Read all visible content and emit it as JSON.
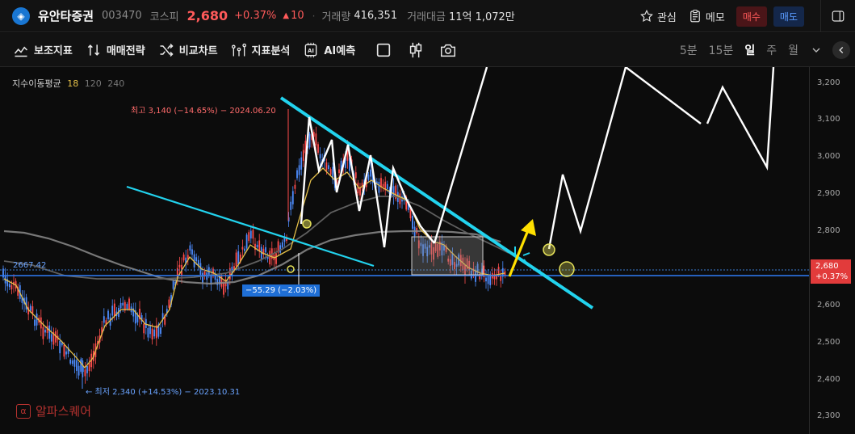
{
  "header": {
    "logo_glyph": "◈",
    "stock_name": "유안타증권",
    "stock_code": "003470",
    "market": "코스피",
    "price": "2,680",
    "change_pct": "+0.37%",
    "change_arrow": "▲",
    "change_value": "10",
    "separator": "·",
    "volume_label": "거래량",
    "volume_value": "416,351",
    "amount_label": "거래대금",
    "amount_value": "11억 1,072만",
    "watch_label": "관심",
    "memo_label": "메모",
    "buy_label": "매수",
    "sell_label": "매도"
  },
  "toolbar": {
    "items": [
      {
        "label": "보조지표",
        "icon": "indicator-icon"
      },
      {
        "label": "매매전략",
        "icon": "strategy-icon"
      },
      {
        "label": "비교차트",
        "icon": "compare-icon"
      },
      {
        "label": "지표분석",
        "icon": "analysis-icon"
      },
      {
        "label": "AI예측",
        "icon": "ai-icon"
      }
    ],
    "periods": [
      "5분",
      "15분",
      "일",
      "주",
      "월"
    ],
    "active_period": "일"
  },
  "chart": {
    "ma_legend_title": "지수이동평균",
    "ma_periods": [
      "18",
      "120",
      "240"
    ],
    "high_label": "최고 3,140 (−14.65%) − 2024.06.20",
    "low_label": "← 최저 2,340 (+14.53%) − 2023.10.31",
    "reference_label": "2667.42",
    "diff_label": "−55.29 (−2.03%)",
    "current_price_tag": "2,680",
    "current_pct_tag": "+0.37%",
    "watermark": "알파스퀘어",
    "colors": {
      "up": "#ff4d4d",
      "down": "#4d8dff",
      "ma18": "#e6c14a",
      "trend": "#22d3ee",
      "arrow": "#ffe000"
    }
  },
  "chart_data": {
    "type": "candlestick",
    "y_axis_ticks": [
      "3,200",
      "3,100",
      "3,000",
      "2,900",
      "2,800",
      "2,700",
      "2,600",
      "2,500",
      "2,400",
      "2,300"
    ],
    "ylim": [
      2255,
      3245
    ],
    "high": 3140,
    "low": 2340,
    "current": 2680,
    "reference": 2667.42
  }
}
